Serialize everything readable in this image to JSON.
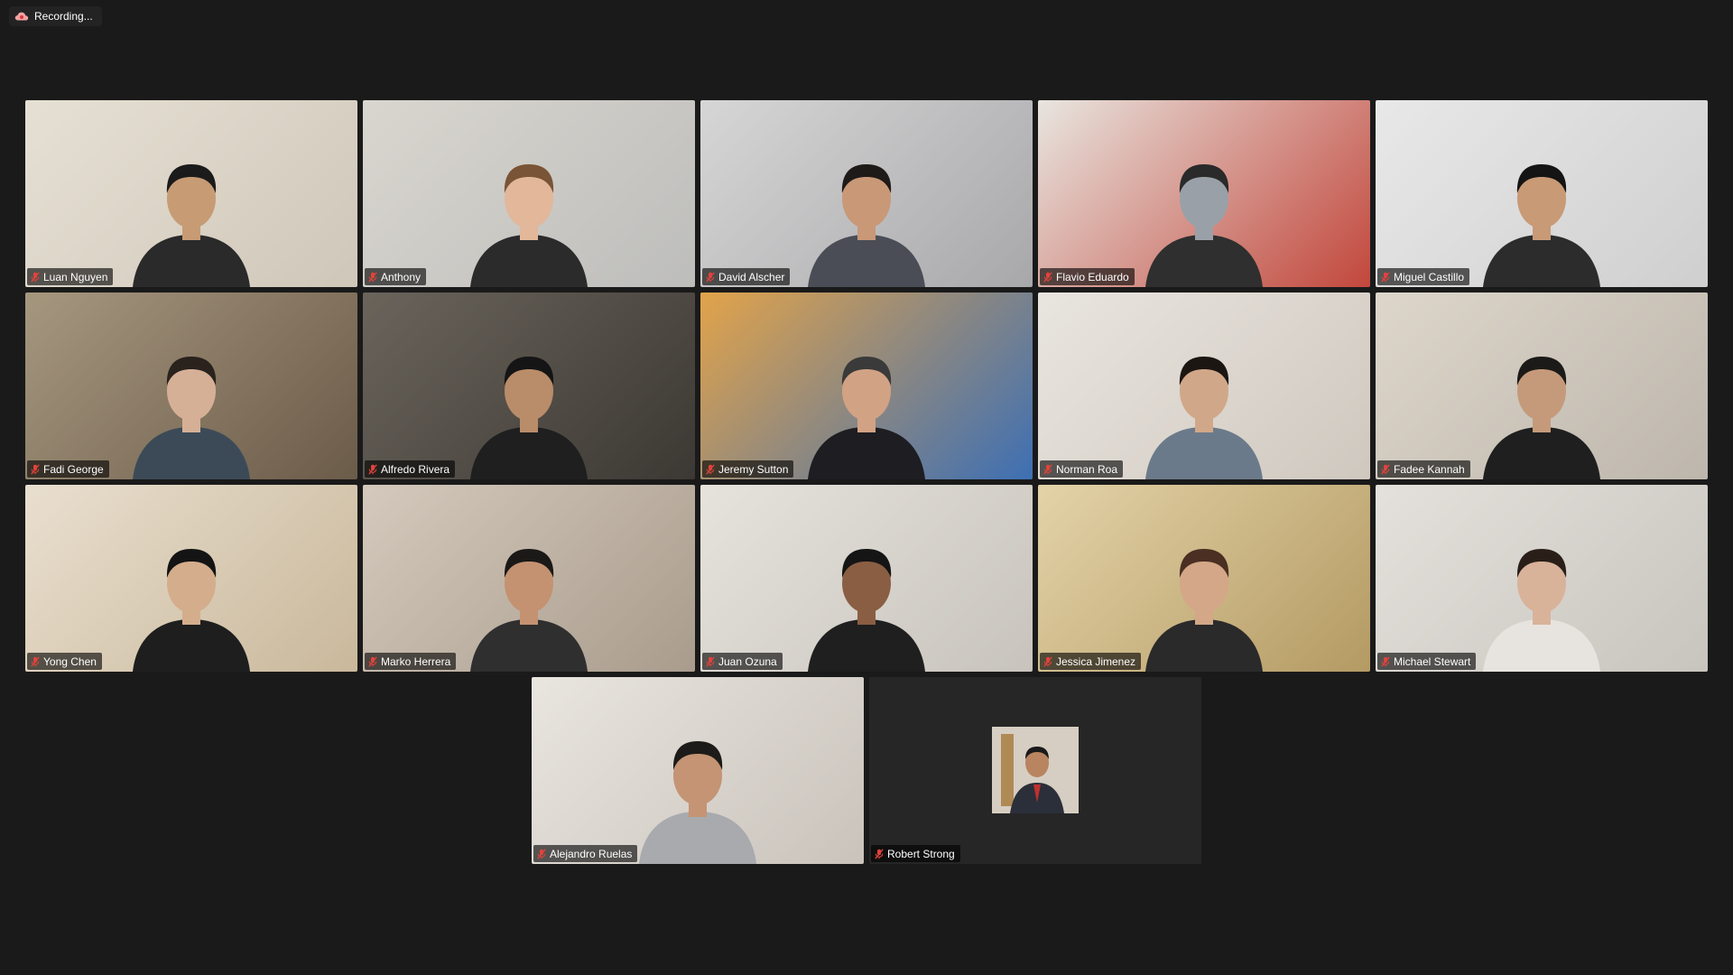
{
  "window": {
    "recording_label": "Recording..."
  },
  "participants": [
    {
      "name": "Luan Nguyen",
      "mic": "muted",
      "bg1": "#cfc7b9",
      "bg2": "#e6e0d4",
      "shirt": "#2a2a2a",
      "skin": "#c79b74",
      "hair": "#1b1b1b"
    },
    {
      "name": "Anthony",
      "mic": "muted",
      "bg1": "#bdbdbb",
      "bg2": "#d9d6cf",
      "shirt": "#2b2b2b",
      "skin": "#e2b79a",
      "hair": "#7a5436"
    },
    {
      "name": "David Alscher",
      "mic": "muted",
      "bg1": "#a8a8ab",
      "bg2": "#d6d6d6",
      "shirt": "#4a4d56",
      "skin": "#c99877",
      "hair": "#1e1a18"
    },
    {
      "name": "Flavio Eduardo",
      "mic": "muted",
      "bg1": "#c2473c",
      "bg2": "#e8e5df",
      "shirt": "#2f2f2f",
      "skin": "#9aa0a8",
      "hair": "#2a2a2a"
    },
    {
      "name": "Miguel Castillo",
      "mic": "muted",
      "bg1": "#cfcfcf",
      "bg2": "#e8e8e8",
      "shirt": "#2c2c2c",
      "skin": "#c89a76",
      "hair": "#141414"
    },
    {
      "name": "Fadi George",
      "mic": "muted",
      "bg1": "#6b5b49",
      "bg2": "#a6977f",
      "shirt": "#3c4a58",
      "skin": "#d5b097",
      "hair": "#2a221d"
    },
    {
      "name": "Alfredo Rivera",
      "mic": "muted",
      "bg1": "#3c3833",
      "bg2": "#6a645b",
      "shirt": "#1f1f1f",
      "skin": "#b98c6a",
      "hair": "#151515"
    },
    {
      "name": "Jeremy Sutton",
      "mic": "muted",
      "active": true,
      "bg1": "#3d6fb4",
      "bg2": "#e2a34a",
      "shirt": "#1d1d22",
      "skin": "#d2a284",
      "hair": "#3a3a3a"
    },
    {
      "name": "Norman Roa",
      "mic": "muted",
      "bg1": "#cfc8bf",
      "bg2": "#e9e5df",
      "shirt": "#6b7a8a",
      "skin": "#d1a789",
      "hair": "#1b1612"
    },
    {
      "name": "Fadee Kannah",
      "mic": "muted",
      "bg1": "#bdb6ac",
      "bg2": "#ddd6cb",
      "shirt": "#1f1f1f",
      "skin": "#c59a7a",
      "hair": "#1c1a18"
    },
    {
      "name": "Yong Chen",
      "mic": "muted",
      "bg1": "#c9b89b",
      "bg2": "#e9dfcf",
      "shirt": "#1e1e1e",
      "skin": "#d4ad8c",
      "hair": "#141414"
    },
    {
      "name": "Marko Herrera",
      "mic": "muted",
      "bg1": "#a99c8d",
      "bg2": "#d4c9bc",
      "shirt": "#2f2f2f",
      "skin": "#c49271",
      "hair": "#1b1917"
    },
    {
      "name": "Juan Ozuna",
      "mic": "muted",
      "bg1": "#c8c3bd",
      "bg2": "#e6e2dc",
      "shirt": "#1f1f1f",
      "skin": "#8a5e42",
      "hair": "#151515"
    },
    {
      "name": "Jessica Jimenez",
      "mic": "muted",
      "bg1": "#b49a63",
      "bg2": "#e3d3a8",
      "shirt": "#2a2a2a",
      "skin": "#d3a787",
      "hair": "#4a2f22"
    },
    {
      "name": "Michael Stewart",
      "mic": "muted",
      "bg1": "#c8c4be",
      "bg2": "#e4e1dc",
      "shirt": "#e7e4df",
      "skin": "#d9b29a",
      "hair": "#2a1f18"
    },
    {
      "name": "Alejandro Ruelas",
      "mic": "muted",
      "bg1": "#c9c3bb",
      "bg2": "#e9e5df",
      "shirt": "#a8aaad",
      "skin": "#c49474",
      "hair": "#1d1b19"
    },
    {
      "name": "Robert Strong",
      "mic": "muted",
      "video_off": true,
      "bg1": "#262626",
      "bg2": "#262626",
      "shirt": "#2b2f3a",
      "skin": "#b98460",
      "hair": "#1a1a1a"
    }
  ],
  "colors": {
    "mute_icon": "#e0433b",
    "active_speaker": "#23c552",
    "recording_icon": "#f0a3a3"
  }
}
